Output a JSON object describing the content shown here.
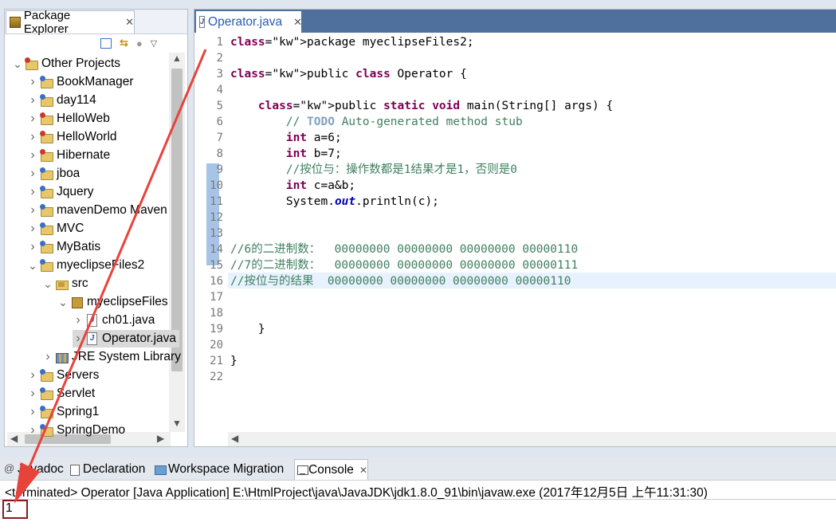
{
  "package_explorer": {
    "tab_label": "Package Explorer",
    "items": [
      {
        "label": "Other Projects",
        "level": 0,
        "expanded": true,
        "icon": "working-set-icon"
      },
      {
        "label": "BookManager",
        "level": 1,
        "icon": "java-project-icon"
      },
      {
        "label": "day114",
        "level": 1,
        "icon": "java-project-icon"
      },
      {
        "label": "HelloWeb",
        "level": 1,
        "icon": "web-project-icon"
      },
      {
        "label": "HelloWorld",
        "level": 1,
        "icon": "web-project-icon"
      },
      {
        "label": "Hibernate",
        "level": 1,
        "icon": "web-project-icon"
      },
      {
        "label": "jboa",
        "level": 1,
        "icon": "java-project-icon"
      },
      {
        "label": "Jquery",
        "level": 1,
        "icon": "java-project-icon"
      },
      {
        "label": "mavenDemo Maven",
        "level": 1,
        "icon": "maven-project-icon"
      },
      {
        "label": "MVC",
        "level": 1,
        "icon": "java-project-icon"
      },
      {
        "label": "MyBatis",
        "level": 1,
        "icon": "java-project-icon"
      },
      {
        "label": "myeclipseFiles2",
        "level": 1,
        "expanded": true,
        "icon": "java-project-icon"
      },
      {
        "label": "src",
        "level": 2,
        "expanded": true,
        "icon": "source-folder-icon"
      },
      {
        "label": "myeclipseFiles",
        "level": 3,
        "expanded": true,
        "icon": "package-icon"
      },
      {
        "label": "ch01.java",
        "level": 4,
        "icon": "java-file-icon"
      },
      {
        "label": "Operator.java",
        "level": 4,
        "icon": "java-file-icon",
        "selected": true
      },
      {
        "label": "JRE System Library",
        "level": 2,
        "icon": "library-icon"
      },
      {
        "label": "Servers",
        "level": 1,
        "icon": "java-project-icon"
      },
      {
        "label": "Servlet",
        "level": 1,
        "icon": "java-project-icon"
      },
      {
        "label": "Spring1",
        "level": 1,
        "icon": "java-project-icon"
      },
      {
        "label": "SpringDemo",
        "level": 1,
        "icon": "java-project-icon"
      }
    ]
  },
  "editor": {
    "tab_label": "Operator.java",
    "lines": [
      "package myeclipseFiles2;",
      "",
      "public class Operator {",
      "",
      "    public static void main(String[] args) {",
      "        // TODO Auto-generated method stub",
      "        int a=6;",
      "        int b=7;",
      "        //按位与：操作数都是1结果才是1，否则是0",
      "        int c=a&b;",
      "        System.out.println(c);",
      "",
      "",
      "//6的二进制数：  00000000 00000000 00000000 00000110",
      "//7的二进制数：  00000000 00000000 00000000 00000111",
      "//按位与的结果  00000000 00000000 00000000 00000110",
      "",
      "",
      "    }",
      "",
      "}",
      ""
    ]
  },
  "bottom_panel": {
    "tabs": [
      {
        "label": "Javadoc",
        "icon": "javadoc-icon"
      },
      {
        "label": "Declaration",
        "icon": "declaration-icon"
      },
      {
        "label": "Workspace Migration",
        "icon": "workspace-migration-icon"
      },
      {
        "label": "Console",
        "icon": "console-icon",
        "active": true
      }
    ],
    "console_status": "<terminated> Operator [Java Application] E:\\HtmlProject\\java\\JavaJDK\\jdk1.8.0_91\\bin\\javaw.exe (2017年12月5日 上午11:31:30)",
    "console_output": "1"
  },
  "colors": {
    "keyword": "#7f0055",
    "comment": "#3f7f5f",
    "annotation_arrow": "#e8433a",
    "annotation_box": "#8b1a1a"
  }
}
